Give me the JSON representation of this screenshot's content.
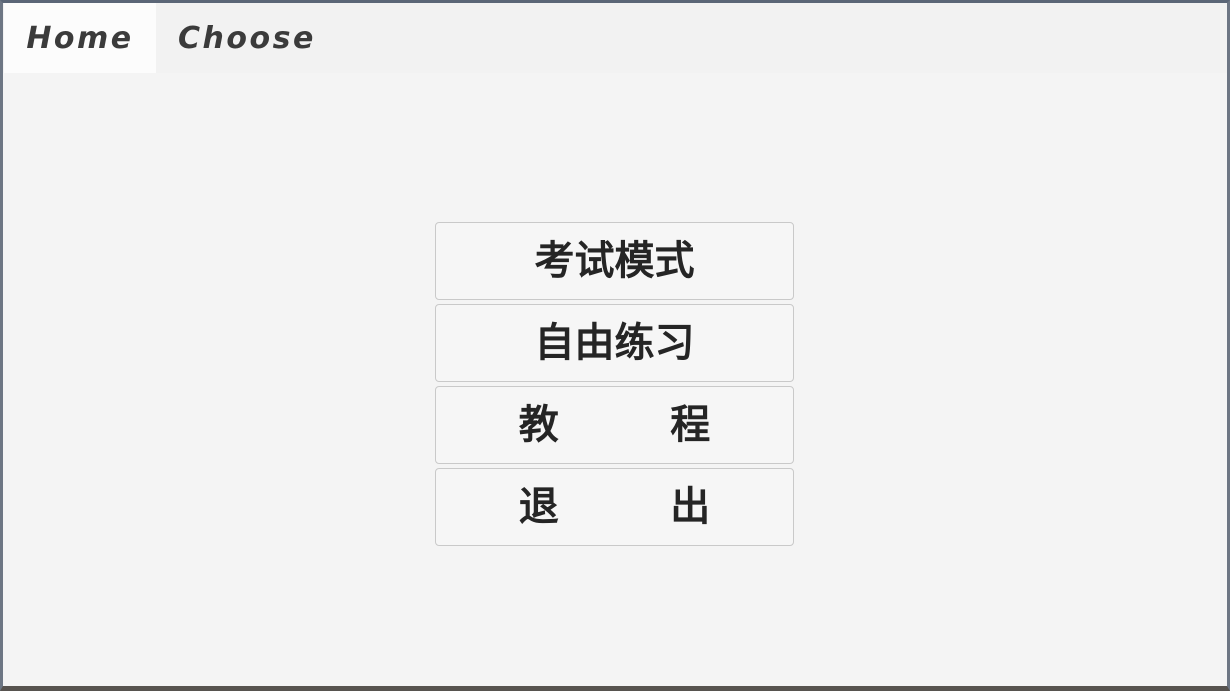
{
  "window": {
    "title": "Home",
    "background_color": "#f4f4f4",
    "frame_color": "#5b6677",
    "bottom_frame_color": "#57534f"
  },
  "tab_bar": {
    "background_color": "#f2f2f2",
    "active_tab_color": "#fcfcfc",
    "text_color": "#3b3b3b",
    "tabs": [
      {
        "id": "home",
        "label": "Home",
        "active": true
      },
      {
        "id": "choose",
        "label": "Choose",
        "active": false
      }
    ]
  },
  "main_menu": {
    "button_background": "#f6f6f6",
    "button_border": "#c9c9c9",
    "button_text_color": "#252525",
    "buttons": [
      {
        "id": "exam-mode",
        "label": "考试模式",
        "spaced": false
      },
      {
        "id": "free-practice",
        "label": "自由练习",
        "spaced": false
      },
      {
        "id": "tutorial",
        "label": "教        程",
        "spaced": true
      },
      {
        "id": "exit",
        "label": "退        出",
        "spaced": true
      }
    ]
  }
}
